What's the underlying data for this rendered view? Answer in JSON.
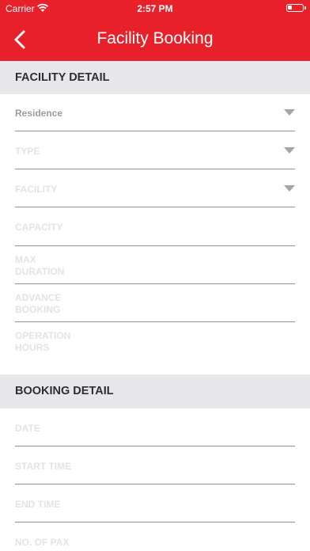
{
  "status_bar": {
    "carrier": "Carrier",
    "time": "2:57 PM",
    "wifi_icon": "wifi-icon",
    "battery_icon": "battery-icon"
  },
  "nav": {
    "title": "Facility Booking",
    "back_icon": "chevron-left-icon"
  },
  "facility_detail": {
    "heading": "FACILITY DETAIL",
    "residence": "Residence",
    "type": "TYPE",
    "facility": "FACILITY",
    "capacity": "CAPACITY",
    "max_duration_1": "MAX",
    "max_duration_2": "DURATION",
    "advance_booking_1": "ADVANCE",
    "advance_booking_2": "BOOKING",
    "operation_hours_1": "OPERATION",
    "operation_hours_2": "HOURS"
  },
  "booking_detail": {
    "heading": "BOOKING DETAIL",
    "date": "DATE",
    "start_time": "START TIME",
    "end_time": "END TIME",
    "no_of_pax": "NO. OF PAX"
  },
  "colors": {
    "brand_red": "#e8202a",
    "section_bg": "#e7e7e9"
  }
}
